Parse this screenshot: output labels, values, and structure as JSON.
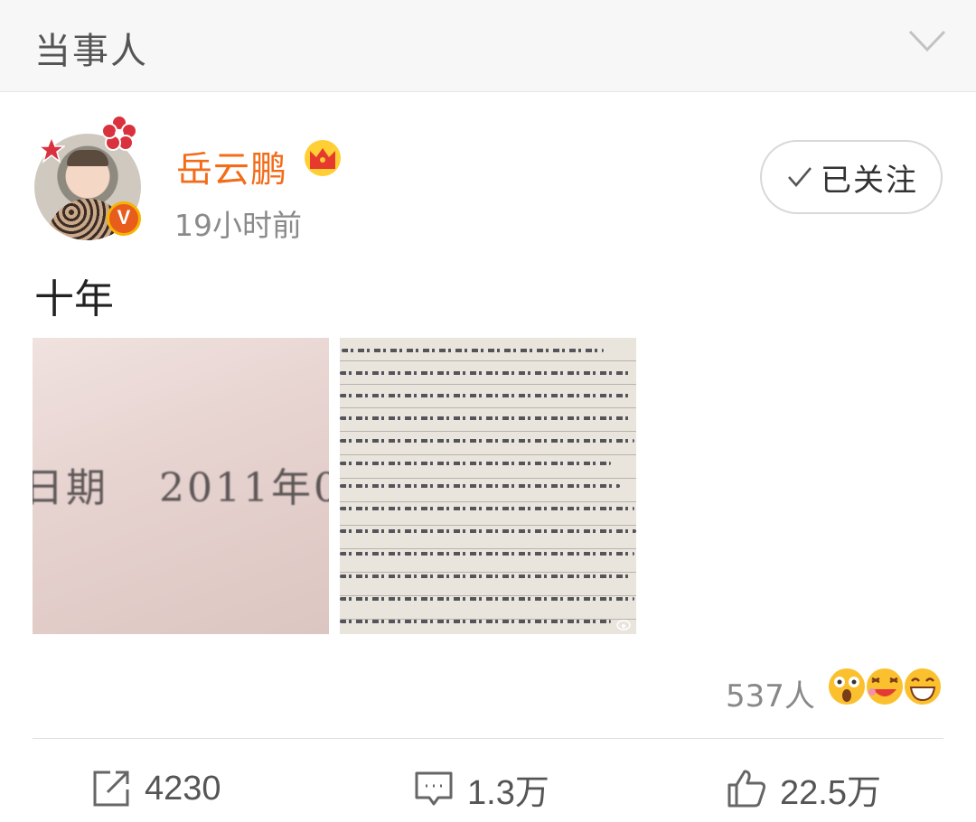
{
  "header": {
    "title": "当事人",
    "collapse_icon": "chevron-down-icon"
  },
  "post": {
    "author": {
      "name": "岳云鹏",
      "verified_badge": "V",
      "member_icon": "crown-icon",
      "name_color": "#f26c1a"
    },
    "time": "19小时前",
    "follow": {
      "label": "已关注",
      "icon": "check-icon"
    },
    "text": "十年",
    "images": [
      {
        "name": "certificate-photo",
        "visible_text_1": "日期",
        "visible_text_2": "2011年0"
      },
      {
        "name": "handwritten-letter-photo"
      }
    ],
    "reactions": {
      "count_label": "537人",
      "emoji_icons": [
        "surprised-emoji-icon",
        "laughing-emoji-icon",
        "grinning-emoji-icon"
      ]
    },
    "actions": {
      "repost": {
        "icon": "share-icon",
        "count": "4230"
      },
      "comment": {
        "icon": "comment-icon",
        "count": "1.3万"
      },
      "like": {
        "icon": "thumbs-up-icon",
        "count": "22.5万"
      }
    }
  }
}
